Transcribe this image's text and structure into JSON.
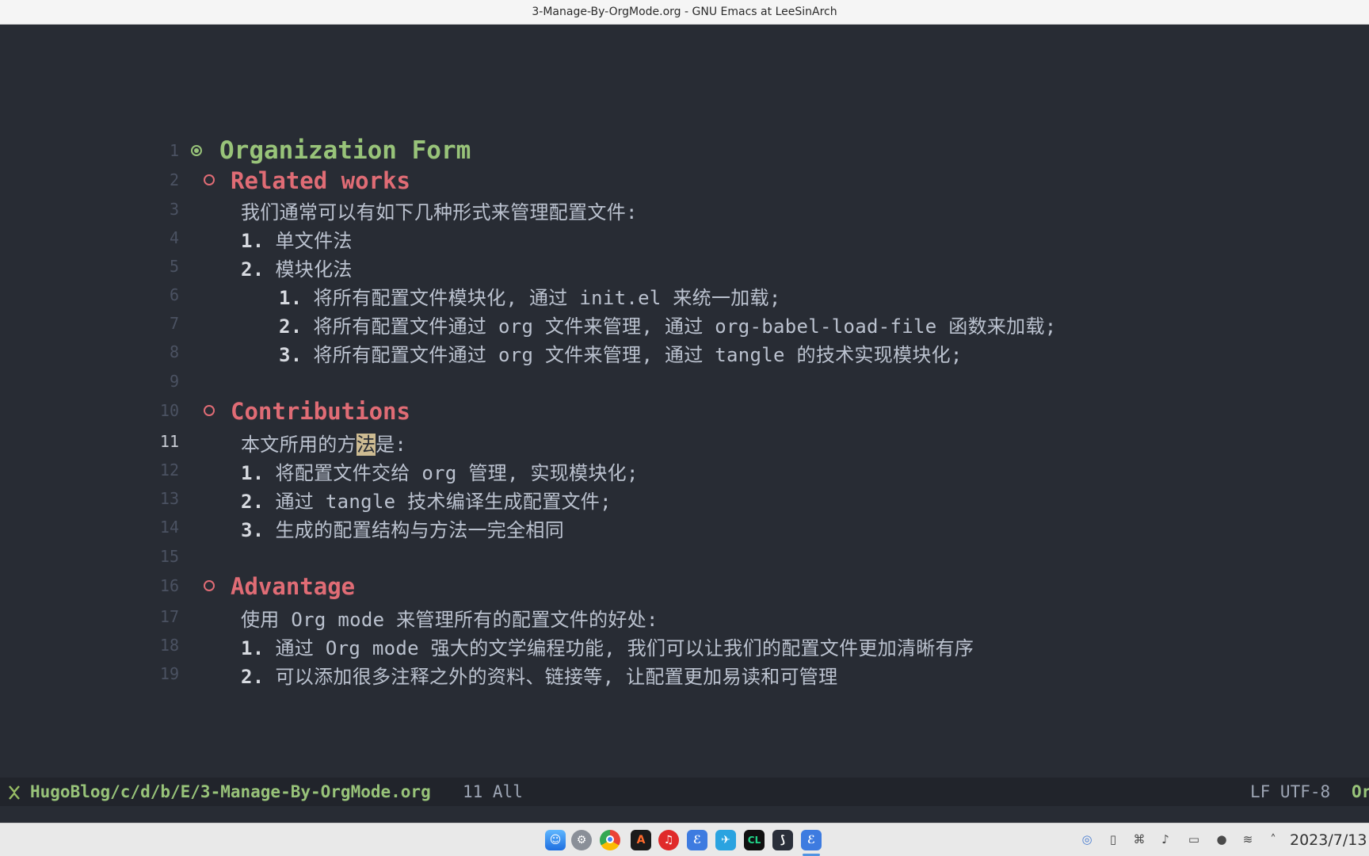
{
  "window": {
    "title": "3-Manage-By-OrgMode.org - GNU Emacs at LeeSinArch"
  },
  "buffer": {
    "lines": [
      {
        "n": "1",
        "heading": "Organization Form"
      },
      {
        "n": "2",
        "heading": "Related works"
      },
      {
        "n": "3",
        "text": "我们通常可以有如下几种形式来管理配置文件:"
      },
      {
        "n": "4",
        "num": "1.",
        "text": "单文件法"
      },
      {
        "n": "5",
        "num": "2.",
        "text": "模块化法"
      },
      {
        "n": "6",
        "num": "1.",
        "text": "将所有配置文件模块化, 通过 init.el 来统一加载;"
      },
      {
        "n": "7",
        "num": "2.",
        "text": "将所有配置文件通过 org 文件来管理, 通过 org-babel-load-file 函数来加载;"
      },
      {
        "n": "8",
        "num": "3.",
        "text": "将所有配置文件通过 org 文件来管理, 通过 tangle 的技术实现模块化;"
      },
      {
        "n": "9"
      },
      {
        "n": "10",
        "heading": "Contributions"
      },
      {
        "n": "11",
        "text_before": "本文所用的方",
        "cursor_char": "法",
        "text_after": "是:"
      },
      {
        "n": "12",
        "num": "1.",
        "text": "将配置文件交给 org 管理, 实现模块化;"
      },
      {
        "n": "13",
        "num": "2.",
        "text": "通过 tangle 技术编译生成配置文件;"
      },
      {
        "n": "14",
        "num": "3.",
        "text": "生成的配置结构与方法一完全相同"
      },
      {
        "n": "15"
      },
      {
        "n": "16",
        "heading": "Advantage"
      },
      {
        "n": "17",
        "text": "使用 Org mode 来管理所有的配置文件的好处:"
      },
      {
        "n": "18",
        "num": "1.",
        "text": "通过 Org mode 强大的文学编程功能, 我们可以让我们的配置文件更加清晰有序"
      },
      {
        "n": "19",
        "num": "2.",
        "text": "可以添加很多注释之外的资料、链接等, 让配置更加易读和可管理"
      }
    ]
  },
  "modeline": {
    "icon": "emacs-icon",
    "path": "HugoBlog/c/d/b/E/3-Manage-By-OrgMode.org",
    "position": "11 All",
    "encoding": "LF UTF-8",
    "mode": "Or"
  },
  "taskbar": {
    "apps": [
      "finder-icon",
      "settings-icon",
      "chrome-icon",
      "terminal-icon",
      "music-icon",
      "emacs-icon",
      "feishu-icon",
      "clion-icon",
      "app-icon",
      "emacs-icon"
    ],
    "tray": [
      "vpn-icon",
      "clipboard-icon",
      "keyboard-icon",
      "volume-icon",
      "display-icon",
      "mic-icon",
      "wifi-icon",
      "chevron-up-icon"
    ],
    "clock": "2023/7/13"
  },
  "colors": {
    "background": "#282c34",
    "heading1": "#98c379",
    "heading2": "#e06c75",
    "text": "#bbc2cf",
    "cursor": "#cdbb92"
  }
}
